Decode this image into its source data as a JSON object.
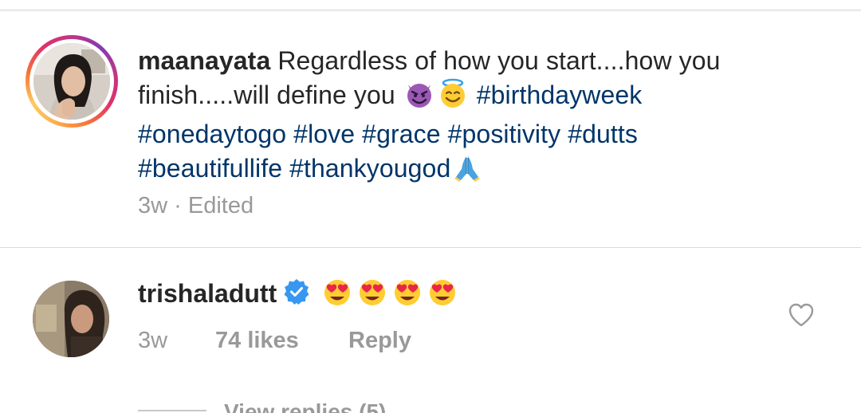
{
  "post_caption": {
    "username": "maanayata",
    "text_before_emoji": "Regardless of how you start....how you finish.....will define you",
    "emojis": [
      "smiling-imp-emoji",
      "halo-emoji"
    ],
    "hashtags_line1": "#birthdayweek",
    "hashtags_line2": [
      "#onedaytogo",
      "#love",
      "#grace",
      "#positivity",
      "#dutts"
    ],
    "hashtags_line3": [
      "#beautifullife",
      "#thankyougod"
    ],
    "trailing_emoji": "folded-hands-emoji",
    "time": "3w",
    "separator": "·",
    "edited_label": "Edited"
  },
  "comment": {
    "username": "trishaladutt",
    "verified": true,
    "verified_color": "#3897f0",
    "emojis": [
      "heart-eyes-emoji",
      "heart-eyes-emoji",
      "heart-eyes-emoji",
      "heart-eyes-emoji"
    ],
    "time": "3w",
    "likes": "74 likes",
    "reply_label": "Reply",
    "view_replies": "View replies (5)"
  },
  "colors": {
    "text": "#262626",
    "hashtag": "#003569",
    "muted": "#999999",
    "divider": "#dbdbdb"
  }
}
